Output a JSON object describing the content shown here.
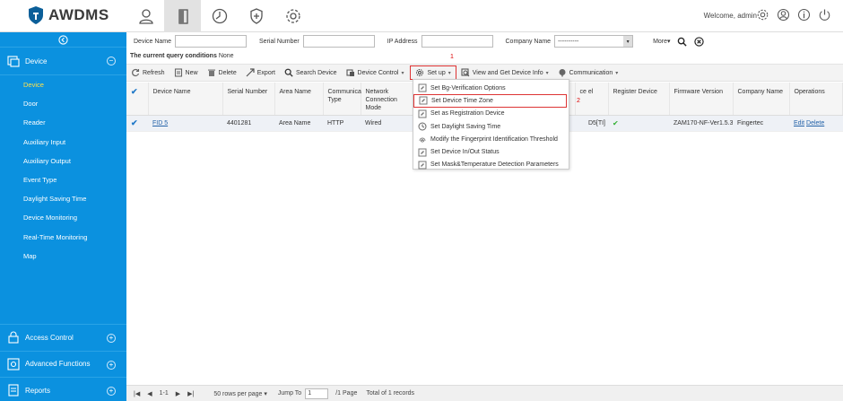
{
  "app": {
    "logo_text": "AWDMS",
    "welcome": "Welcome, admin",
    "brand_color": "#0b91df",
    "accent_color": "#d33333"
  },
  "topnav": [
    "user-icon",
    "door-icon",
    "clock-icon",
    "shield-plus-icon",
    "gear-icon"
  ],
  "sidebar": {
    "device_title": "Device",
    "items": [
      {
        "label": "Device"
      },
      {
        "label": "Door"
      },
      {
        "label": "Reader"
      },
      {
        "label": "Auxiliary Input"
      },
      {
        "label": "Auxiliary Output"
      },
      {
        "label": "Event Type"
      },
      {
        "label": "Daylight Saving Time"
      },
      {
        "label": "Device Monitoring"
      },
      {
        "label": "Real-Time Monitoring"
      },
      {
        "label": "Map"
      }
    ],
    "bottom": [
      {
        "label": "Access Control"
      },
      {
        "label": "Advanced Functions"
      },
      {
        "label": "Reports"
      }
    ]
  },
  "search": {
    "device_name_label": "Device Name",
    "serial_label": "Serial Number",
    "ip_label": "IP Address",
    "company_label": "Company Name",
    "company_value": "----------",
    "more_label": "More"
  },
  "conditions": {
    "label": "The current query conditions",
    "value": "None"
  },
  "toolbar": {
    "refresh": "Refresh",
    "new": "New",
    "delete": "Delete",
    "export": "Export",
    "search_device": "Search Device",
    "device_control": "Device Control",
    "setup": "Set up",
    "view_get": "View and Get Device Info",
    "communication": "Communication",
    "annot1": "1",
    "annot2": "2"
  },
  "table": {
    "headers": [
      "Device Name",
      "Serial Number",
      "Area Name",
      "Communica Type",
      "Network Connection Mode",
      "",
      "ce el",
      "Register Device",
      "Firmware Version",
      "Company Name",
      "Operations"
    ],
    "row": {
      "device_name": "FID 5",
      "serial": "4401281",
      "area": "Area Name",
      "comm_type": "HTTP",
      "network": "Wired",
      "model_tail": "D5[TI]",
      "registered": "✔",
      "firmware": "ZAM170-NF-Ver1.5.3",
      "company": "Fingertec",
      "edit": "Edit",
      "delete": "Delete"
    }
  },
  "setup_menu": [
    {
      "label": "Set Bg-Verification Options"
    },
    {
      "label": "Set Device Time Zone"
    },
    {
      "label": "Set as Registration Device"
    },
    {
      "label": "Set Daylight Saving Time"
    },
    {
      "label": "Modify the Fingerprint Identification Threshold"
    },
    {
      "label": "Set Device In/Out Status"
    },
    {
      "label": "Set Mask&Temperature Detection Parameters"
    }
  ],
  "pager": {
    "range": "1-1",
    "rows_per_page": "50 rows per page",
    "jump_label": "Jump To",
    "jump_value": "1",
    "pages": "/1 Page",
    "total": "Total of 1 records"
  }
}
